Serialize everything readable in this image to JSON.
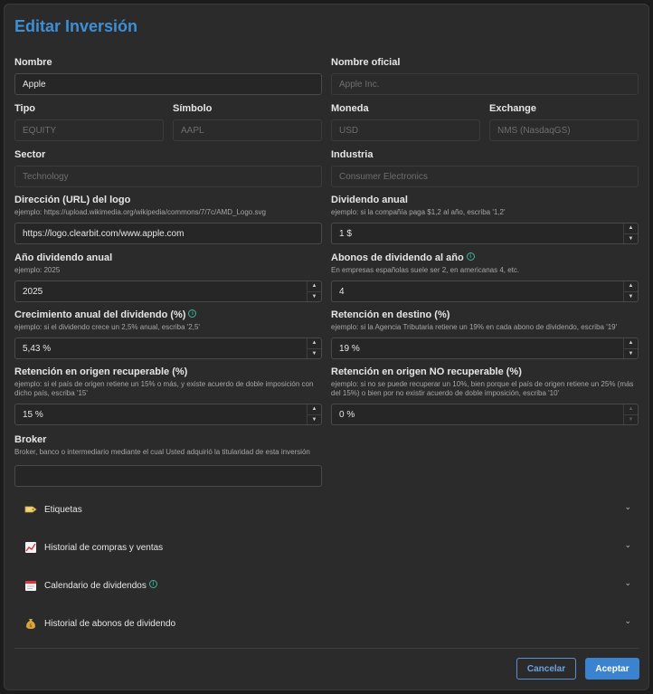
{
  "title": "Editar Inversión",
  "fields": {
    "nombre": {
      "label": "Nombre",
      "value": "Apple"
    },
    "nombre_oficial": {
      "label": "Nombre oficial",
      "value": "Apple Inc."
    },
    "tipo": {
      "label": "Tipo",
      "value": "EQUITY"
    },
    "simbolo": {
      "label": "Símbolo",
      "value": "AAPL"
    },
    "moneda": {
      "label": "Moneda",
      "value": "USD"
    },
    "exchange": {
      "label": "Exchange",
      "value": "NMS (NasdaqGS)"
    },
    "sector": {
      "label": "Sector",
      "value": "Technology"
    },
    "industria": {
      "label": "Industria",
      "value": "Consumer Electronics"
    },
    "logo": {
      "label": "Dirección (URL) del logo",
      "hint": "ejemplo: https://upload.wikimedia.org/wikipedia/commons/7/7c/AMD_Logo.svg",
      "value": "https://logo.clearbit.com/www.apple.com"
    },
    "dividendo_anual": {
      "label": "Dividendo anual",
      "hint": "ejemplo: si la compañía paga $1,2 al año, escriba '1,2'",
      "value": "1 $"
    },
    "anio_dividendo": {
      "label": "Año dividendo anual",
      "hint": "ejemplo: 2025",
      "value": "2025"
    },
    "abonos": {
      "label": "Abonos de dividendo al año",
      "hint": "En empresas españolas suele ser 2, en americanas 4, etc.",
      "value": "4"
    },
    "crecimiento": {
      "label": "Crecimiento anual del dividendo (%)",
      "hint": "ejemplo: si el dividendo crece un 2,5% anual, escriba '2,5'",
      "value": "5,43 %"
    },
    "retencion_destino": {
      "label": "Retención en destino (%)",
      "hint": "ejemplo: si la Agencia Tributaria retiene un 19% en cada abono de dividendo, escriba '19'",
      "value": "19 %"
    },
    "retencion_recuperable": {
      "label": "Retención en origen recuperable (%)",
      "hint": "ejemplo: si el país de origen retiene un 15% o más, y existe acuerdo de doble imposición con dicho país, escriba '15'",
      "value": "15 %"
    },
    "retencion_no_recuperable": {
      "label": "Retención en origen NO recuperable (%)",
      "hint": "ejemplo: si no se puede recuperar un 10%, bien porque el país de origen retiene un 25% (más del 15%) o bien por no existir acuerdo de doble imposición, escriba '10'",
      "value": "0 %"
    },
    "broker": {
      "label": "Broker",
      "hint": "Broker, banco o intermediario mediante el cual Usted adquirió la titularidad de esta inversión",
      "value": ""
    }
  },
  "sections": [
    {
      "label": "Etiquetas",
      "icon": "tag-icon"
    },
    {
      "label": "Historial de compras y ventas",
      "icon": "chart-increasing-icon"
    },
    {
      "label": "Calendario de dividendos",
      "icon": "calendar-icon"
    },
    {
      "label": "Historial de abonos de dividendo",
      "icon": "money-bag-icon"
    }
  ],
  "buttons": {
    "cancel": "Cancelar",
    "ok": "Aceptar"
  },
  "colors": {
    "accent": "#3d8fd6",
    "info": "#3fb39a"
  }
}
